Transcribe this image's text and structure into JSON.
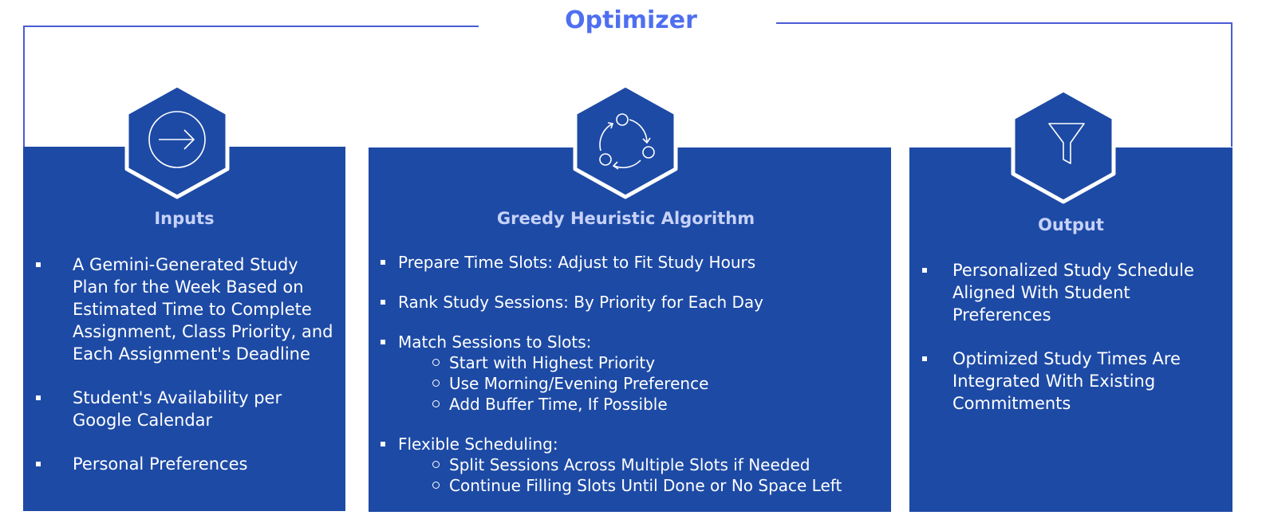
{
  "title": "Optimizer",
  "colors": {
    "panel": "#1d4aa5",
    "title": "#4f6ff0",
    "heading": "#c7d2f8",
    "frame": "#4a5bd6"
  },
  "panels": [
    {
      "title": "Inputs",
      "icon": "arrow-right-circle-icon",
      "items": [
        {
          "text": "A Gemini-Generated Study Plan for the Week Based on Estimated Time to Complete Assignment, Class Priority, and Each Assignment's Deadline"
        },
        {
          "text": "Student's Availability per Google Calendar"
        },
        {
          "text": "Personal Preferences"
        }
      ]
    },
    {
      "title": "Greedy Heuristic Algorithm",
      "icon": "cycle-icon",
      "items": [
        {
          "text": "Prepare Time Slots: Adjust to Fit Study Hours"
        },
        {
          "text": "Rank Study Sessions: By Priority for Each Day"
        },
        {
          "text": "Match Sessions to Slots:",
          "sub": [
            "Start with Highest Priority",
            "Use Morning/Evening Preference",
            "Add Buffer Time, If Possible"
          ]
        },
        {
          "text": "Flexible Scheduling:",
          "sub": [
            "Split Sessions Across Multiple Slots if Needed",
            "Continue Filling Slots Until Done or No Space Left"
          ]
        }
      ]
    },
    {
      "title": "Output",
      "icon": "funnel-icon",
      "items": [
        {
          "text": "Personalized Study Schedule Aligned With Student Preferences"
        },
        {
          "text": "Optimized Study Times Are Integrated With Existing Commitments"
        }
      ]
    }
  ]
}
